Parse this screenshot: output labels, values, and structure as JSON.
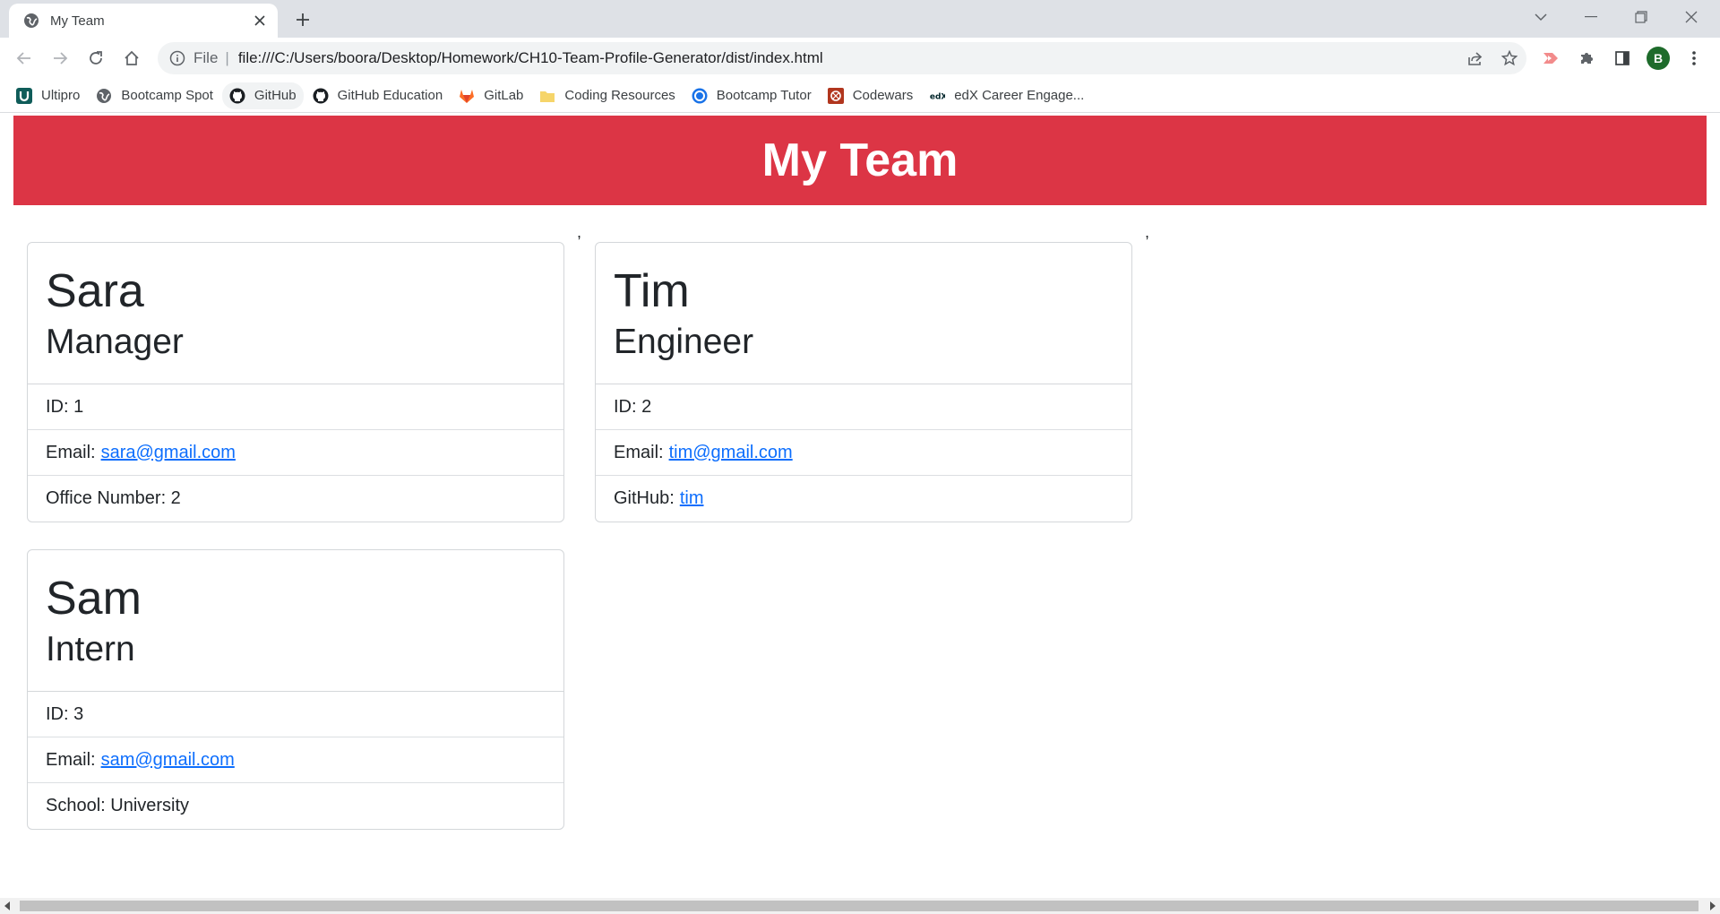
{
  "browser": {
    "tab_title": "My Team",
    "address_scheme": "File",
    "address_url": "file:///C:/Users/boora/Desktop/Homework/CH10-Team-Profile-Generator/dist/index.html",
    "profile_initial": "B",
    "accent_color": "#1a73e8"
  },
  "bookmarks": [
    {
      "label": "Ultipro",
      "icon": "ultipro-icon"
    },
    {
      "label": "Bootcamp Spot",
      "icon": "globe-icon"
    },
    {
      "label": "GitHub",
      "icon": "github-icon"
    },
    {
      "label": "GitHub Education",
      "icon": "github-icon"
    },
    {
      "label": "GitLab",
      "icon": "gitlab-icon"
    },
    {
      "label": "Coding Resources",
      "icon": "folder-icon"
    },
    {
      "label": "Bootcamp Tutor",
      "icon": "bootcamp-tutor-icon"
    },
    {
      "label": "Codewars",
      "icon": "codewars-icon"
    },
    {
      "label": "edX Career Engage...",
      "icon": "edx-icon"
    }
  ],
  "page": {
    "title": "My Team",
    "banner_color": "#dc3545",
    "separator": ","
  },
  "cards": [
    {
      "name": "Sara",
      "role": "Manager",
      "id_line": "ID: 1",
      "email_prefix": "Email:",
      "email": "sara@gmail.com",
      "extra_line": "Office Number: 2"
    },
    {
      "name": "Tim",
      "role": "Engineer",
      "id_line": "ID: 2",
      "email_prefix": "Email:",
      "email": "tim@gmail.com",
      "extra_prefix": "GitHub:",
      "extra_link": "tim"
    },
    {
      "name": "Sam",
      "role": "Intern",
      "id_line": "ID: 3",
      "email_prefix": "Email:",
      "email": "sam@gmail.com",
      "extra_line": "School: University"
    }
  ]
}
